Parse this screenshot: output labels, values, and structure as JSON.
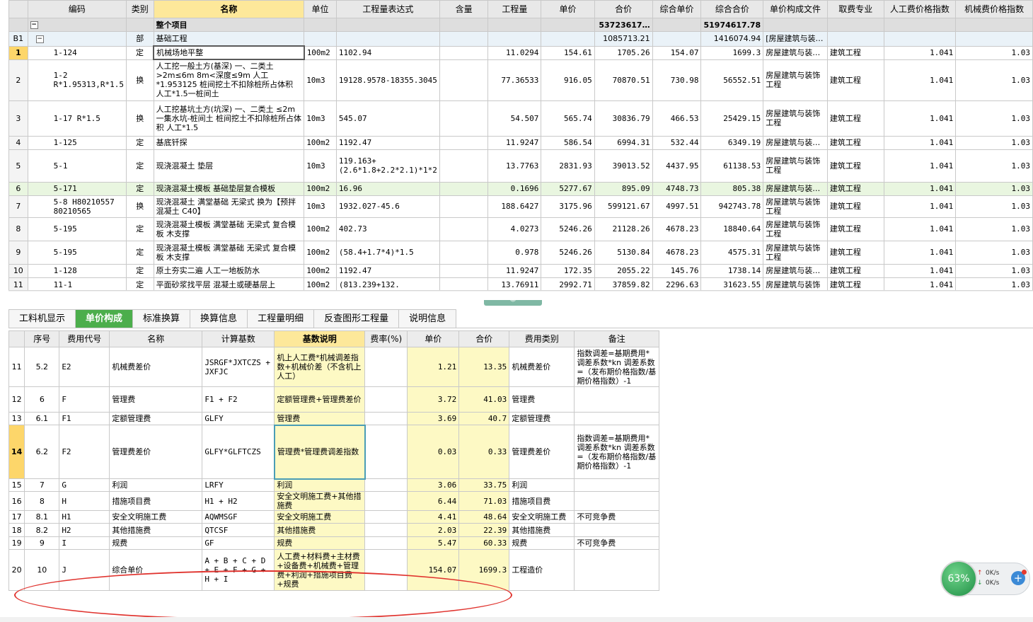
{
  "top_table": {
    "headers": [
      "编码",
      "类别",
      "名称",
      "单位",
      "工程量表达式",
      "含量",
      "工程量",
      "单价",
      "合价",
      "综合单价",
      "综合合价",
      "单价构成文件",
      "取费专业",
      "人工费价格指数",
      "机械费价格指数"
    ],
    "project_row": {
      "name": "整个项目",
      "total": "53723617…",
      "comp_total": "51974617.78"
    },
    "section_row": {
      "id": "B1",
      "type": "部",
      "name": "基础工程",
      "total": "1085713.21",
      "comp_total": "1416074.94",
      "file": "[房屋建筑与装…"
    },
    "rows": [
      {
        "no": "1",
        "code": "1-124",
        "type": "定",
        "name": "机械场地平整",
        "unit": "100m2",
        "expr": "1102.94",
        "qty": "11.0294",
        "price": "154.61",
        "total": "1705.26",
        "cprice": "154.07",
        "ctotal": "1699.3",
        "file": "房屋建筑与装…",
        "spec": "建筑工程",
        "li": "1.041",
        "mi": "1.03"
      },
      {
        "no": "2",
        "code": "1-2 R*1.95313,R*1.5",
        "type": "换",
        "name": "人工挖一般土方(基深) 一、二类土 >2m≤6m 8m<深度≤9m 人工*1.953125 桩间挖土不扣除桩所占体积 人工*1.5一桩间土",
        "unit": "10m3",
        "expr": "19128.9578-18355.3045",
        "qty": "77.36533",
        "price": "916.05",
        "total": "70870.51",
        "cprice": "730.98",
        "ctotal": "56552.51",
        "file": "房屋建筑与装饰工程",
        "spec": "建筑工程",
        "li": "1.041",
        "mi": "1.03"
      },
      {
        "no": "3",
        "code": "1-17 R*1.5",
        "type": "换",
        "name": "人工挖基坑土方(坑深) 一、二类土 ≤2m一集水坑-桩间土 桩间挖土不扣除桩所占体积 人工*1.5",
        "unit": "10m3",
        "expr": "545.07",
        "qty": "54.507",
        "price": "565.74",
        "total": "30836.79",
        "cprice": "466.53",
        "ctotal": "25429.15",
        "file": "房屋建筑与装饰工程",
        "spec": "建筑工程",
        "li": "1.041",
        "mi": "1.03"
      },
      {
        "no": "4",
        "code": "1-125",
        "type": "定",
        "name": "基底钎探",
        "unit": "100m2",
        "expr": "1192.47",
        "qty": "11.9247",
        "price": "586.54",
        "total": "6994.31",
        "cprice": "532.44",
        "ctotal": "6349.19",
        "file": "房屋建筑与装…",
        "spec": "建筑工程",
        "li": "1.041",
        "mi": "1.03"
      },
      {
        "no": "5",
        "code": "5-1",
        "type": "定",
        "name": "现浇混凝土 垫层",
        "unit": "10m3",
        "expr": "119.163+(2.6*1.8+2.2*2.1)*1*2",
        "qty": "13.7763",
        "price": "2831.93",
        "total": "39013.52",
        "cprice": "4437.95",
        "ctotal": "61138.53",
        "file": "房屋建筑与装饰工程",
        "spec": "建筑工程",
        "li": "1.041",
        "mi": "1.03"
      },
      {
        "no": "6",
        "code": "5-171",
        "type": "定",
        "name": "现浇混凝土模板 基础垫层复合模板",
        "unit": "100m2",
        "expr": "16.96",
        "qty": "0.1696",
        "price": "5277.67",
        "total": "895.09",
        "cprice": "4748.73",
        "ctotal": "805.38",
        "file": "房屋建筑与装…",
        "spec": "建筑工程",
        "li": "1.041",
        "mi": "1.03"
      },
      {
        "no": "7",
        "code": "5-8 H80210557 80210565",
        "type": "换",
        "name": "现浇混凝土 满堂基础 无梁式 换为【预拌混凝土 C40】",
        "unit": "10m3",
        "expr": "1932.027-45.6",
        "qty": "188.6427",
        "price": "3175.96",
        "total": "599121.67",
        "cprice": "4997.51",
        "ctotal": "942743.78",
        "file": "房屋建筑与装饰工程",
        "spec": "建筑工程",
        "li": "1.041",
        "mi": "1.03"
      },
      {
        "no": "8",
        "code": "5-195",
        "type": "定",
        "name": "现浇混凝土模板 满堂基础 无梁式 复合模板 木支撑",
        "unit": "100m2",
        "expr": "402.73",
        "qty": "4.0273",
        "price": "5246.26",
        "total": "21128.26",
        "cprice": "4678.23",
        "ctotal": "18840.64",
        "file": "房屋建筑与装饰工程",
        "spec": "建筑工程",
        "li": "1.041",
        "mi": "1.03"
      },
      {
        "no": "9",
        "code": "5-195",
        "type": "定",
        "name": "现浇混凝土模板 满堂基础 无梁式 复合模板 木支撑",
        "unit": "100m2",
        "expr": "(58.4+1.7*4)*1.5",
        "qty": "0.978",
        "price": "5246.26",
        "total": "5130.84",
        "cprice": "4678.23",
        "ctotal": "4575.31",
        "file": "房屋建筑与装饰工程",
        "spec": "建筑工程",
        "li": "1.041",
        "mi": "1.03"
      },
      {
        "no": "10",
        "code": "1-128",
        "type": "定",
        "name": "原土夯实二遍 人工一地板防水",
        "unit": "100m2",
        "expr": "1192.47",
        "qty": "11.9247",
        "price": "172.35",
        "total": "2055.22",
        "cprice": "145.76",
        "ctotal": "1738.14",
        "file": "房屋建筑与装…",
        "spec": "建筑工程",
        "li": "1.041",
        "mi": "1.03"
      },
      {
        "no": "11",
        "code": "11-1",
        "type": "定",
        "name": "平面砂浆找平层 混凝土或硬基层上",
        "unit": "100m2",
        "expr": "(813.239+132.",
        "qty": "13.76911",
        "price": "2992.71",
        "total": "37859.82",
        "cprice": "2296.63",
        "ctotal": "31623.55",
        "file": "房屋建筑与装饰",
        "spec": "建筑工程",
        "li": "1.041",
        "mi": "1.03"
      }
    ]
  },
  "tabs": [
    "工料机显示",
    "单价构成",
    "标准换算",
    "换算信息",
    "工程量明细",
    "反查图形工程量",
    "说明信息"
  ],
  "active_tab": "单价构成",
  "bottom_table": {
    "headers": [
      "序号",
      "费用代号",
      "名称",
      "计算基数",
      "基数说明",
      "费率(%)",
      "单价",
      "合价",
      "费用类别",
      "备注"
    ],
    "rows": [
      {
        "rn": "11",
        "seq": "5.2",
        "code": "E2",
        "name": "机械费差价",
        "base": "JSRGF*JXTCZS + JXFJC",
        "desc": "机上人工费*机械调差指数+机械价差（不含机上人工）",
        "rate": "",
        "price": "1.21",
        "total": "13.35",
        "cat": "机械费差价",
        "note": "指数调差=基期费用*调差系数*kn 调差系数=（发布期价格指数/基期价格指数）-1"
      },
      {
        "rn": "12",
        "seq": "6",
        "code": "F",
        "name": "管理费",
        "base": "F1 + F2",
        "desc": "定额管理费+管理费差价",
        "rate": "",
        "price": "3.72",
        "total": "41.03",
        "cat": "管理费",
        "note": ""
      },
      {
        "rn": "13",
        "seq": "6.1",
        "code": "F1",
        "name": "定额管理费",
        "base": "GLFY",
        "desc": "管理费",
        "rate": "",
        "price": "3.69",
        "total": "40.7",
        "cat": "定额管理费",
        "note": ""
      },
      {
        "rn": "14",
        "seq": "6.2",
        "code": "F2",
        "name": "管理费差价",
        "base": "GLFY*GLFTCZS",
        "desc": "管理费*管理费调差指数",
        "rate": "",
        "price": "0.03",
        "total": "0.33",
        "cat": "管理费差价",
        "note": "指数调差=基期费用*调差系数*kn 调差系数=（发布期价格指数/基期价格指数）-1"
      },
      {
        "rn": "15",
        "seq": "7",
        "code": "G",
        "name": "利润",
        "base": "LRFY",
        "desc": "利润",
        "rate": "",
        "price": "3.06",
        "total": "33.75",
        "cat": "利润",
        "note": ""
      },
      {
        "rn": "16",
        "seq": "8",
        "code": "H",
        "name": "措施项目费",
        "base": "H1 + H2",
        "desc": "安全文明施工费+其他措施费",
        "rate": "",
        "price": "6.44",
        "total": "71.03",
        "cat": "措施项目费",
        "note": ""
      },
      {
        "rn": "17",
        "seq": "8.1",
        "code": "H1",
        "name": "安全文明施工费",
        "base": "AQWMSGF",
        "desc": "安全文明施工费",
        "rate": "",
        "price": "4.41",
        "total": "48.64",
        "cat": "安全文明施工费",
        "note": "不可竞争费"
      },
      {
        "rn": "18",
        "seq": "8.2",
        "code": "H2",
        "name": "其他措施费",
        "base": "QTCSF",
        "desc": "其他措施费",
        "rate": "",
        "price": "2.03",
        "total": "22.39",
        "cat": "其他措施费",
        "note": ""
      },
      {
        "rn": "19",
        "seq": "9",
        "code": "I",
        "name": "规费",
        "base": "GF",
        "desc": "规费",
        "rate": "",
        "price": "5.47",
        "total": "60.33",
        "cat": "规费",
        "note": "不可竞争费"
      },
      {
        "rn": "20",
        "seq": "10",
        "code": "J",
        "name": "综合单价",
        "base": "A + B + C + D + E + F + G + H + I",
        "desc": "人工费+材料费+主材费+设备费+机械费+管理费+利润+措施项目费+规费",
        "rate": "",
        "price": "154.07",
        "total": "1699.3",
        "cat": "工程造价",
        "note": ""
      }
    ]
  },
  "speed_widget": {
    "percent": "63%",
    "up": "0K/s",
    "down": "0K/s"
  },
  "colors": {
    "tab_active": "#4cae4c",
    "highlight_header": "#fde89a",
    "yellow_cell": "#fdf9c4",
    "annotation": "#e0332e"
  }
}
